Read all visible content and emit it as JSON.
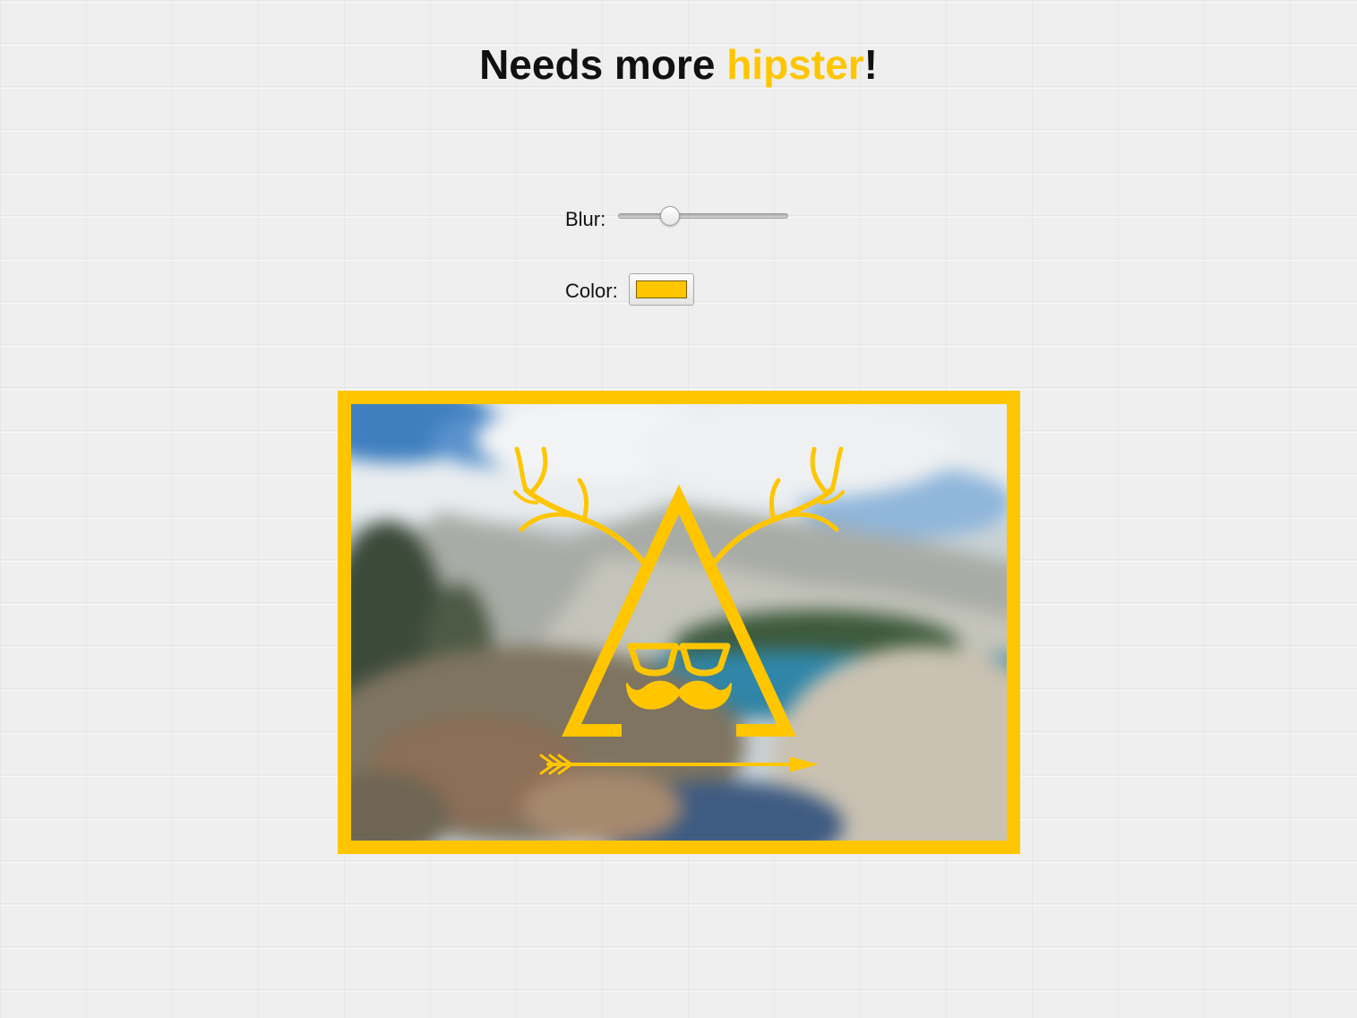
{
  "header": {
    "title_prefix": "Needs more ",
    "title_accent": "hipster",
    "title_suffix": "!"
  },
  "controls": {
    "blur_label": "Blur:",
    "blur_value": 0.28,
    "color_label": "Color:",
    "color_value": "#ffc600"
  },
  "image": {
    "logo_elements": [
      "antlers-icon",
      "triangle-icon",
      "glasses-icon",
      "mustache-icon",
      "arrow-icon"
    ]
  },
  "colors": {
    "accent": "#ffc600",
    "text": "#111111",
    "background": "#efefef"
  }
}
